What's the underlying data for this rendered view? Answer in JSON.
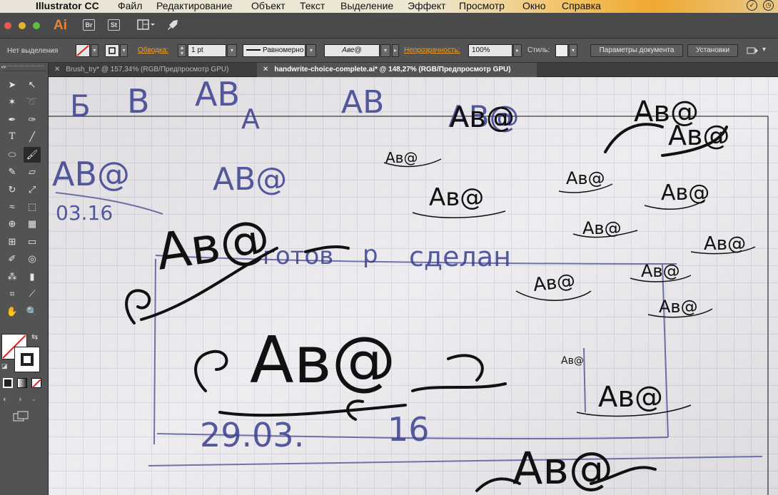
{
  "menubar": {
    "app_name": "Illustrator CC",
    "items": [
      "Файл",
      "Редактирование",
      "Объект",
      "Текст",
      "Выделение",
      "Эффект",
      "Просмотр",
      "Окно",
      "Справка"
    ]
  },
  "appbar": {
    "logo": "Ai",
    "bridge": "Br",
    "stock": "St"
  },
  "control_bar": {
    "selection_status": "Нет выделения",
    "stroke_label": "Обводка:",
    "stroke_weight": "1 pt",
    "stroke_profile": "Равномерно",
    "brush_preview": "Аве@",
    "opacity_label": "Непрозрачность:",
    "opacity_value": "100%",
    "style_label": "Стиль:",
    "doc_setup_button": "Параметры документа",
    "preferences_button": "Установки"
  },
  "tabs": [
    {
      "label": "Brush_try* @ 157,34% (RGB/Предпросмотр GPU)",
      "active": false
    },
    {
      "label": "handwrite-choice-complete.ai* @ 148,27% (RGB/Предпросмотр GPU)",
      "active": true
    }
  ],
  "canvas": {
    "pen_sketch_texts": [
      "Б",
      "В",
      "АВ",
      "А",
      "АВ",
      "АВ@",
      "АВ@",
      "03.16",
      "АВ@",
      "готов",
      "р",
      "сделан",
      "29.03.",
      "16"
    ],
    "ink_texts": [
      "Ав@",
      "Ав@",
      "Ав@",
      "Ав@",
      "Ав@",
      "Ав@",
      "Ав@",
      "Ав@",
      "Ав@",
      "Ав@",
      "Ав@",
      "Ав@",
      "Ав@",
      "Ав@",
      "Ав@",
      "Ав@"
    ]
  },
  "colors": {
    "accent": "#f0a030",
    "ink": "#111111",
    "pen": "#3a3f8e",
    "ui_panel": "#535353"
  }
}
